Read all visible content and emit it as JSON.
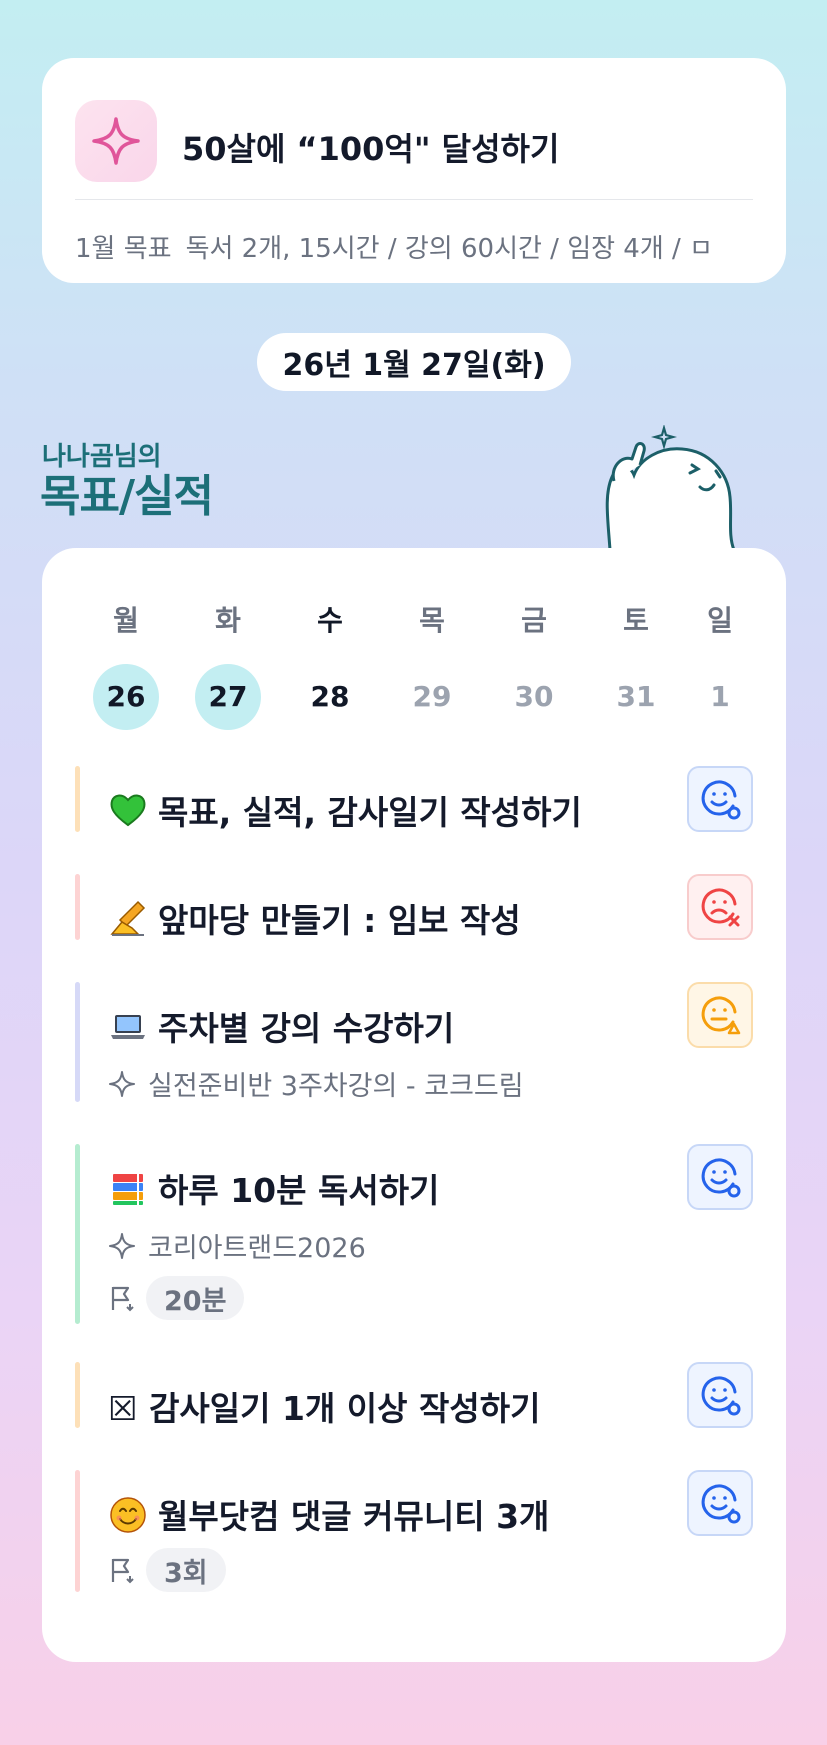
{
  "goal": {
    "title": "50살에 “100억\" 달성하기",
    "month_label": "1월 목표",
    "summary": "독서 2개, 15시간 / 강의 60시간 / 임장 4개 / ㅁ",
    "icon": "sparkle-icon"
  },
  "date": "26년 1월 27일(화)",
  "section": {
    "owner": "나나곰님의",
    "title": "목표/실적"
  },
  "week": [
    {
      "day": "월",
      "date": "26",
      "state": "done"
    },
    {
      "day": "화",
      "date": "27",
      "state": "done"
    },
    {
      "day": "수",
      "date": "28",
      "state": "today"
    },
    {
      "day": "목",
      "date": "29",
      "state": "future"
    },
    {
      "day": "금",
      "date": "30",
      "state": "future"
    },
    {
      "day": "토",
      "date": "31",
      "state": "future"
    },
    {
      "day": "일",
      "date": "1",
      "state": "future"
    }
  ],
  "tasks": [
    {
      "emoji": "green-heart-icon",
      "title": "목표, 실적, 감사일기 작성하기",
      "bar_color": "#fde0b8",
      "status": "good",
      "status_color": "#2563eb"
    },
    {
      "emoji": "writing-hand-icon",
      "title": "앞마당 만들기 : 임보 작성",
      "bar_color": "#fdd3d3",
      "status": "bad",
      "status_color": "#ef4444"
    },
    {
      "emoji": "laptop-icon",
      "title": "주차별 강의 수강하기",
      "bar_color": "#d6d9f7",
      "status": "neutral",
      "status_color": "#f59e0b",
      "linked": "실전준비반 3주차강의 - 코크드림"
    },
    {
      "emoji": "books-icon",
      "title": "하루 10분 독서하기",
      "bar_color": "#b5ecd0",
      "status": "good",
      "status_color": "#2563eb",
      "linked": "코리아트랜드2026",
      "target": "20분"
    },
    {
      "emoji": "",
      "title": "☒ 감사일기 1개 이상 작성하기",
      "bar_color": "#fde0b8",
      "status": "good",
      "status_color": "#2563eb"
    },
    {
      "emoji": "smiling-face-icon",
      "title": "월부닷컴 댓글 커뮤니티 3개",
      "bar_color": "#fdd3d3",
      "status": "good",
      "status_color": "#2563eb",
      "target": "3회"
    }
  ]
}
